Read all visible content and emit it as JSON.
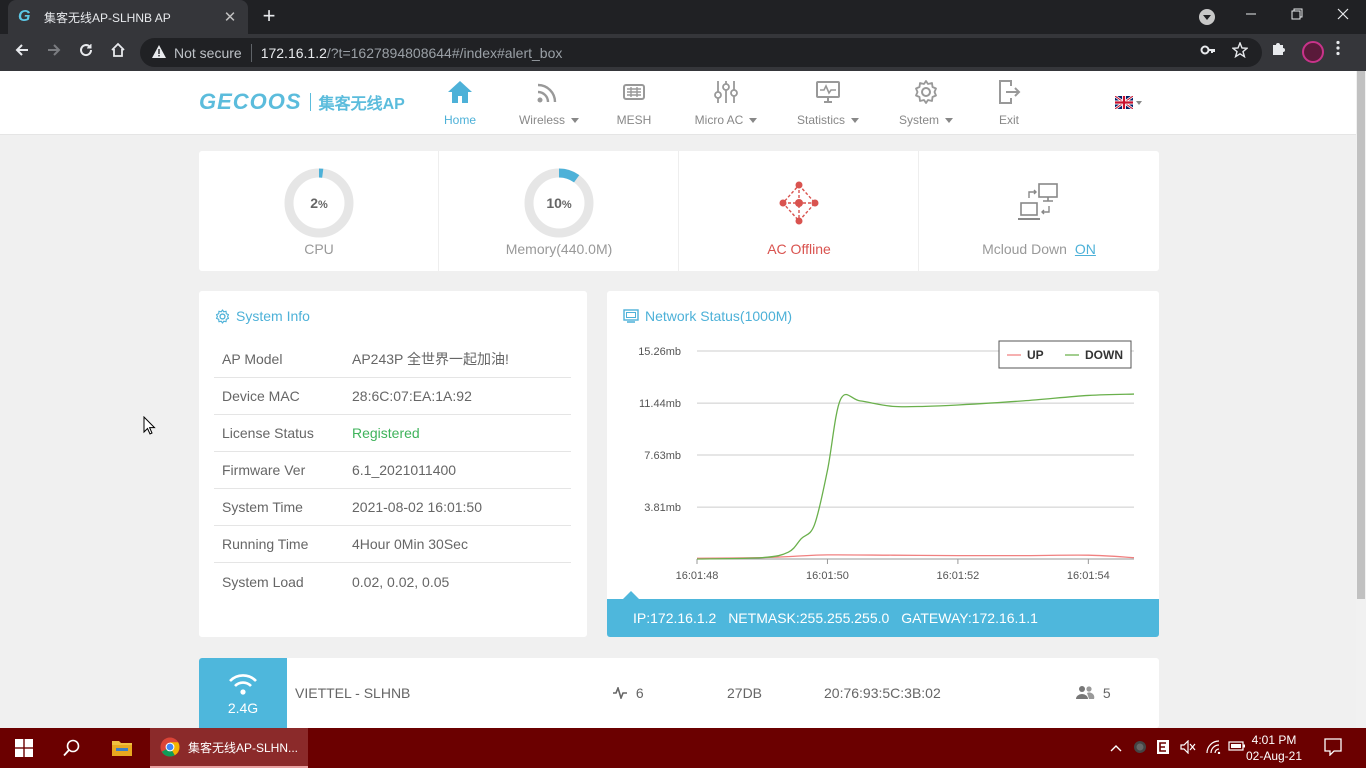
{
  "browser": {
    "tab_title": "集客无线AP-SLHNB AP",
    "tab_close": "✕",
    "new_tab": "+",
    "not_secure": "Not secure",
    "url_host": "172.16.1.2",
    "url_path": "/?t=1627894808644#/index#alert_box"
  },
  "header": {
    "logo_latin": "GECOOS",
    "logo_cn": "集客无线AP",
    "nav": [
      {
        "label": "Home",
        "icon": "home-icon",
        "active": true
      },
      {
        "label": "Wireless",
        "icon": "wifi-icon",
        "dropdown": true
      },
      {
        "label": "MESH",
        "icon": "mesh-icon"
      },
      {
        "label": "Micro AC",
        "icon": "sliders-icon",
        "dropdown": true
      },
      {
        "label": "Statistics",
        "icon": "monitor-pulse-icon",
        "dropdown": true
      },
      {
        "label": "System",
        "icon": "gear-icon",
        "dropdown": true
      },
      {
        "label": "Exit",
        "icon": "exit-icon"
      }
    ],
    "language_icon": "uk-flag-icon"
  },
  "status": {
    "cpu": {
      "value": "2",
      "unit": "%",
      "percent": 2,
      "label": "CPU"
    },
    "memory": {
      "value": "10",
      "unit": "%",
      "percent": 10,
      "label": "Memory(440.0M)"
    },
    "ac": {
      "label": "AC Offline",
      "color": "#d9534f"
    },
    "mcloud": {
      "label": "Mcloud Down",
      "state": "ON"
    }
  },
  "system_info": {
    "title": "System Info",
    "rows": [
      {
        "key": "AP Model",
        "value": "AP243P 全世界一起加油!"
      },
      {
        "key": "Device MAC",
        "value": "28:6C:07:EA:1A:92"
      },
      {
        "key": "License Status",
        "value": "Registered"
      },
      {
        "key": "Firmware Ver",
        "value": "6.1_2021011400"
      },
      {
        "key": "System Time",
        "value": "2021-08-02 16:01:50"
      },
      {
        "key": "Running Time",
        "value": "4Hour 0Min 30Sec"
      },
      {
        "key": "System Load",
        "value": "0.02, 0.02, 0.05"
      }
    ]
  },
  "network_status": {
    "title": "Network Status(1000M)",
    "ip": "IP:172.16.1.2",
    "netmask": "NETMASK:255.255.255.0",
    "gateway": "GATEWAY:172.16.1.1"
  },
  "chart_data": {
    "type": "line",
    "title": "",
    "xlabel": "",
    "ylabel": "",
    "y_ticks": [
      "3.81mb",
      "7.63mb",
      "11.44mb",
      "15.26mb"
    ],
    "y_tick_values": [
      3.81,
      7.63,
      11.44,
      15.26
    ],
    "x_ticks": [
      "16:01:48",
      "16:01:50",
      "16:01:52",
      "16:01:54"
    ],
    "x_tick_values": [
      0,
      2,
      4,
      6
    ],
    "ylim": [
      0,
      15.26
    ],
    "xlim": [
      0,
      6.7
    ],
    "grid": true,
    "legend_position": "top-right",
    "series": [
      {
        "name": "UP",
        "color": "#f08080",
        "x": [
          0,
          1,
          1.5,
          2,
          3,
          4,
          5,
          6,
          6.7
        ],
        "y": [
          0.05,
          0.1,
          0.2,
          0.3,
          0.28,
          0.25,
          0.25,
          0.28,
          0.1
        ]
      },
      {
        "name": "DOWN",
        "color": "#6ab04c",
        "x": [
          0,
          1,
          1.4,
          1.6,
          1.8,
          2.0,
          2.2,
          2.5,
          3.0,
          3.5,
          4,
          5,
          6,
          6.7
        ],
        "y": [
          0,
          0.1,
          0.5,
          1.5,
          2.5,
          6.5,
          11.7,
          11.6,
          11.2,
          11.2,
          11.3,
          11.6,
          12.0,
          12.1
        ]
      }
    ]
  },
  "ssid": {
    "band": "2.4G",
    "name": "VIETTEL - SLHNB",
    "channel": "6",
    "power": "27DB",
    "bssid": "20:76:93:5C:3B:02",
    "clients": "5"
  },
  "taskbar": {
    "app_label": "集客无线AP-SLHN...",
    "time": "4:01 PM",
    "date": "02-Aug-21"
  },
  "colors": {
    "accent": "#4db1d8",
    "registered": "#3fb35b",
    "ac_offline": "#d9534f",
    "taskbar": "#6b0000"
  }
}
